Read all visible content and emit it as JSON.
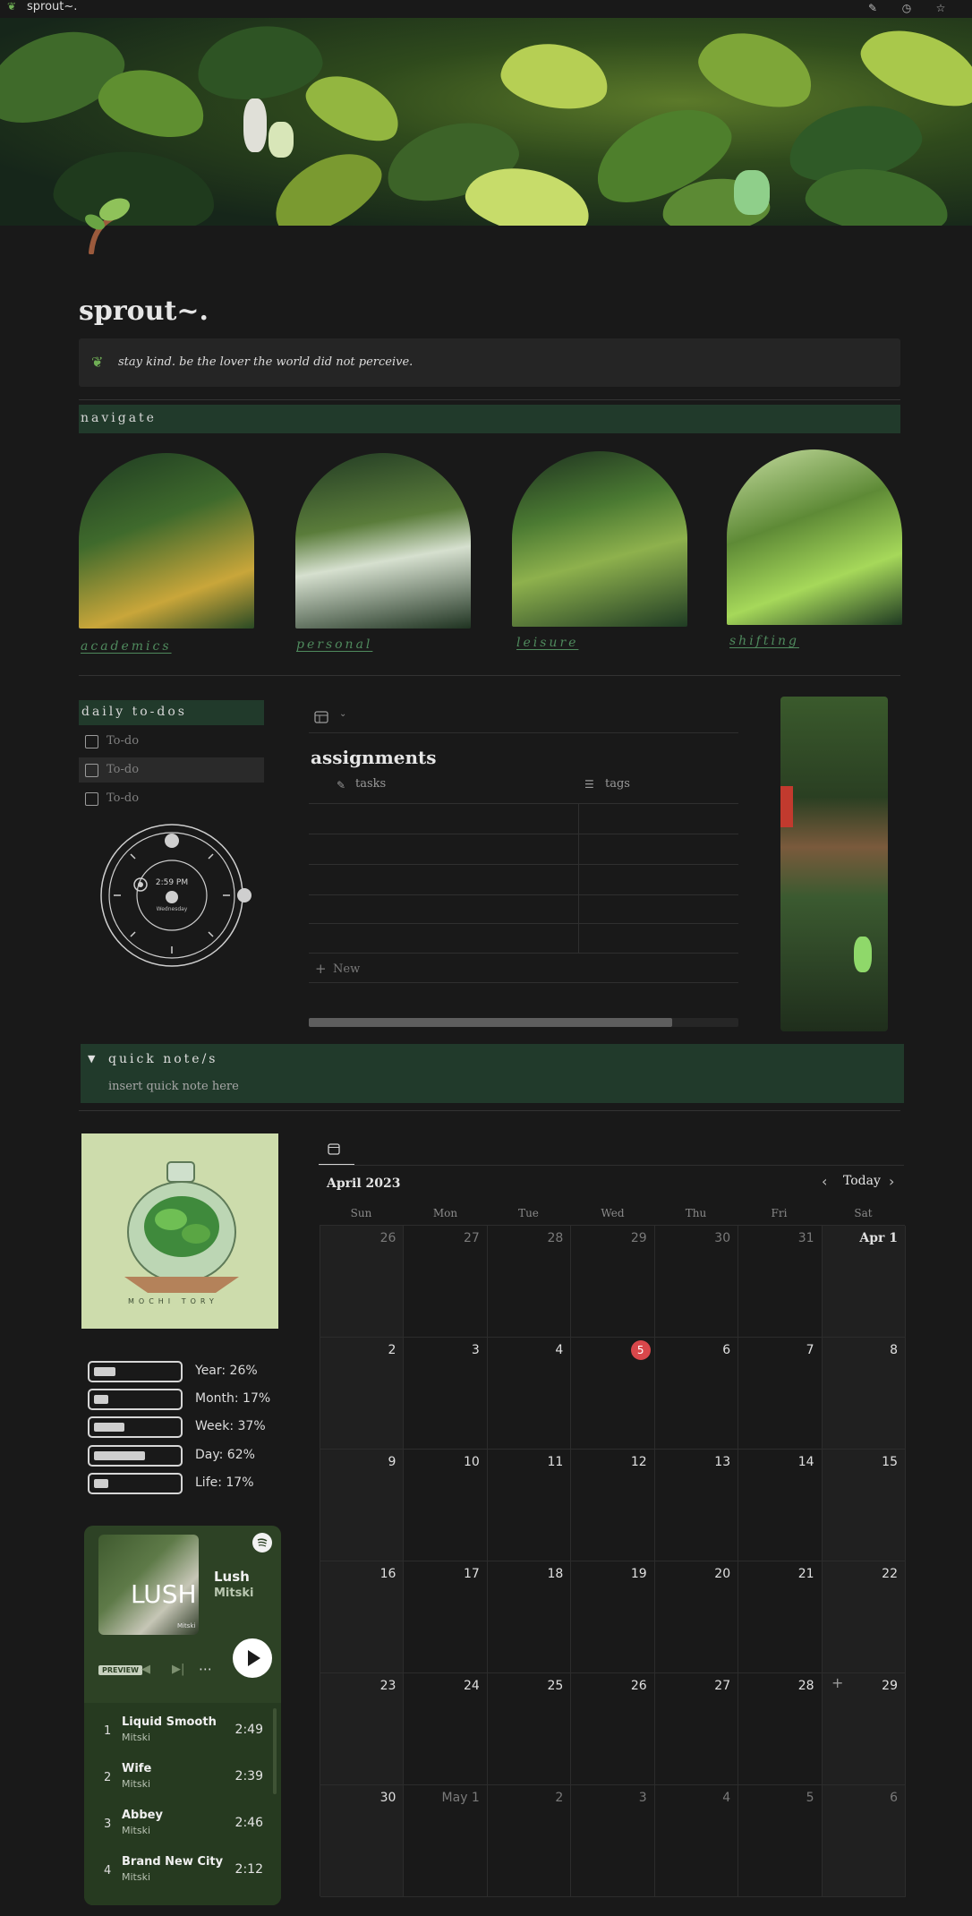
{
  "window": {
    "title": "sprout~."
  },
  "page": {
    "title": "sprout~.",
    "callout": "stay kind. be the lover the world did not perceive."
  },
  "navigate": {
    "header": "navigate",
    "items": [
      {
        "label": "academics"
      },
      {
        "label": "personal"
      },
      {
        "label": "leisure"
      },
      {
        "label": "shifting"
      }
    ]
  },
  "todos": {
    "header": "daily to-dos",
    "items": [
      {
        "label": "To-do"
      },
      {
        "label": "To-do"
      },
      {
        "label": "To-do"
      }
    ]
  },
  "clock": {
    "time": "2:59 PM",
    "day": "Wednesday"
  },
  "assignments": {
    "title": "assignments",
    "columns": [
      "tasks",
      "tags"
    ],
    "new_label": "New"
  },
  "quick_note": {
    "header": "quick note/s",
    "placeholder": "insert quick note here"
  },
  "terrarium": {
    "brand": "MOCHI TORY"
  },
  "progress": [
    {
      "label": "Year: 26%",
      "value": 26
    },
    {
      "label": "Month: 17%",
      "value": 17
    },
    {
      "label": "Week: 37%",
      "value": 37
    },
    {
      "label": "Day: 62%",
      "value": 62
    },
    {
      "label": "Life: 17%",
      "value": 17
    }
  ],
  "spotify": {
    "album_title": "LUSH",
    "album_artist": "Mitski",
    "title": "Lush",
    "artist": "Mitski",
    "preview_label": "PREVIEW",
    "tracks": [
      {
        "n": "1",
        "title": "Liquid Smooth",
        "artist": "Mitski",
        "duration": "2:49"
      },
      {
        "n": "2",
        "title": "Wife",
        "artist": "Mitski",
        "duration": "2:39"
      },
      {
        "n": "3",
        "title": "Abbey",
        "artist": "Mitski",
        "duration": "2:46"
      },
      {
        "n": "4",
        "title": "Brand New City",
        "artist": "Mitski",
        "duration": "2:12"
      }
    ]
  },
  "calendar": {
    "month": "April 2023",
    "today_label": "Today",
    "weekdays": [
      "Sun",
      "Mon",
      "Tue",
      "Wed",
      "Thu",
      "Fri",
      "Sat"
    ],
    "weeks": [
      [
        "26",
        "27",
        "28",
        "29",
        "30",
        "31",
        "Apr 1"
      ],
      [
        "2",
        "3",
        "4",
        "5",
        "6",
        "7",
        "8"
      ],
      [
        "9",
        "10",
        "11",
        "12",
        "13",
        "14",
        "15"
      ],
      [
        "16",
        "17",
        "18",
        "19",
        "20",
        "21",
        "22"
      ],
      [
        "23",
        "24",
        "25",
        "26",
        "27",
        "28",
        "29"
      ],
      [
        "30",
        "May 1",
        "2",
        "3",
        "4",
        "5",
        "6"
      ]
    ],
    "today": "5",
    "accent": "#d9474b"
  }
}
